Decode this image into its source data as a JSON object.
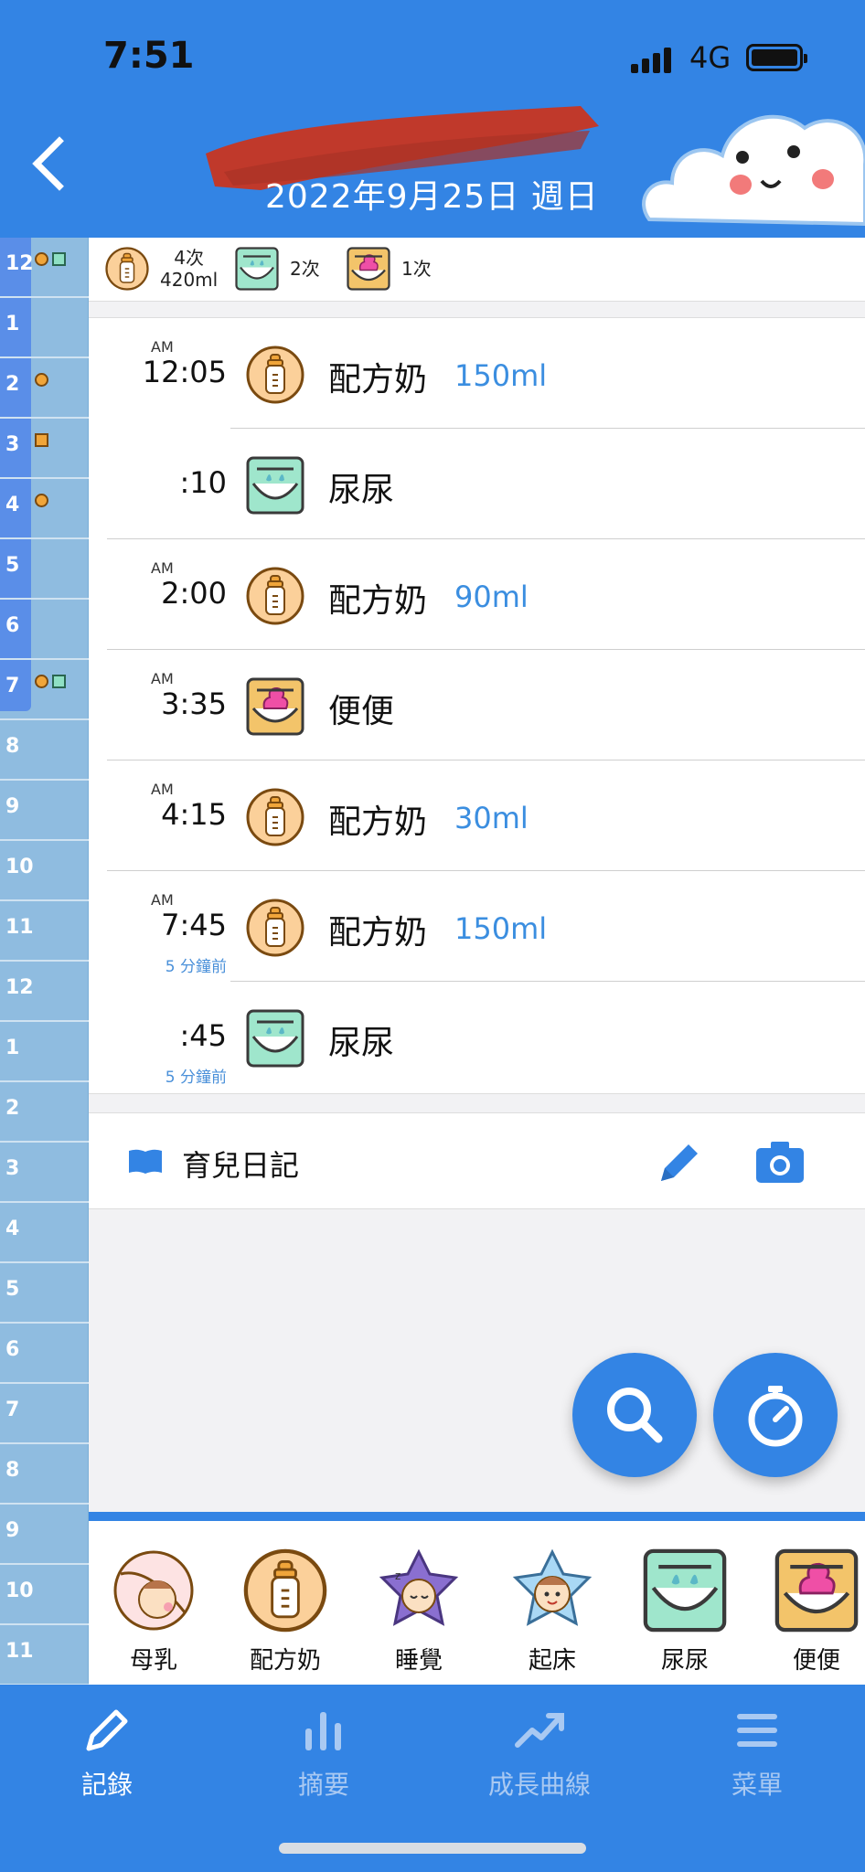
{
  "status_bar": {
    "time": "7:51",
    "network": "4G"
  },
  "header": {
    "date": "2022年9月25日 週日"
  },
  "timeline": {
    "hours": [
      "12",
      "1",
      "2",
      "3",
      "4",
      "5",
      "6",
      "7",
      "8",
      "9",
      "10",
      "11",
      "12",
      "1",
      "2",
      "3",
      "4",
      "5",
      "6",
      "7",
      "8",
      "9",
      "10",
      "11"
    ]
  },
  "summary": {
    "feeding": {
      "count": "4次",
      "total": "420ml"
    },
    "pee": {
      "count": "2次"
    },
    "poop": {
      "count": "1次"
    }
  },
  "entries": [
    {
      "ampm": "AM",
      "time": "12:05",
      "label": "配方奶",
      "amount": "150ml",
      "icon": "bottle-icon",
      "ago": ""
    },
    {
      "ampm": "",
      "time": ":10",
      "label": "尿尿",
      "amount": "",
      "icon": "diaper-pee-icon",
      "ago": ""
    },
    {
      "ampm": "AM",
      "time": "2:00",
      "label": "配方奶",
      "amount": "90ml",
      "icon": "bottle-icon",
      "ago": ""
    },
    {
      "ampm": "AM",
      "time": "3:35",
      "label": "便便",
      "amount": "",
      "icon": "diaper-poop-icon",
      "ago": ""
    },
    {
      "ampm": "AM",
      "time": "4:15",
      "label": "配方奶",
      "amount": "30ml",
      "icon": "bottle-icon",
      "ago": ""
    },
    {
      "ampm": "AM",
      "time": "7:45",
      "label": "配方奶",
      "amount": "150ml",
      "icon": "bottle-icon",
      "ago": "5 分鐘前"
    },
    {
      "ampm": "",
      "time": ":45",
      "label": "尿尿",
      "amount": "",
      "icon": "diaper-pee-icon",
      "ago": "5 分鐘前"
    }
  ],
  "diary": {
    "title": "育兒日記"
  },
  "quick_add": [
    "母乳",
    "配方奶",
    "睡覺",
    "起床",
    "尿尿",
    "便便"
  ],
  "tabs": [
    "記錄",
    "摘要",
    "成長曲線",
    "菜單"
  ],
  "colors": {
    "primary": "#3384e4",
    "accent_text": "#3b8ee0",
    "timeline": "#8fbce0"
  }
}
